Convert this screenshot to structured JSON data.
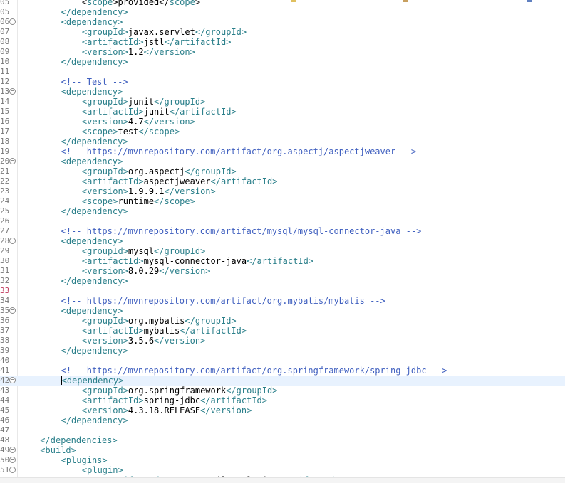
{
  "lines": [
    {
      "n": "05",
      "fold": false,
      "indent": 3,
      "parts": [
        [
          "txt",
          "<"
        ],
        [
          "tag",
          "scope"
        ],
        [
          "txt",
          ">provided</"
        ],
        [
          "tag",
          "scope"
        ],
        [
          "txt",
          ">"
        ]
      ]
    },
    {
      "n": "05",
      "fold": false,
      "indent": 2,
      "parts": [
        [
          "tag",
          "</dependency>"
        ]
      ]
    },
    {
      "n": "06",
      "fold": true,
      "indent": 2,
      "parts": [
        [
          "tag",
          "<dependency>"
        ]
      ]
    },
    {
      "n": "07",
      "fold": false,
      "indent": 3,
      "parts": [
        [
          "tag",
          "<groupId>"
        ],
        [
          "txt",
          "javax.servlet"
        ],
        [
          "tag",
          "</groupId>"
        ]
      ]
    },
    {
      "n": "08",
      "fold": false,
      "indent": 3,
      "parts": [
        [
          "tag",
          "<artifactId>"
        ],
        [
          "txt",
          "jstl"
        ],
        [
          "tag",
          "</artifactId>"
        ]
      ]
    },
    {
      "n": "09",
      "fold": false,
      "indent": 3,
      "parts": [
        [
          "tag",
          "<version>"
        ],
        [
          "txt",
          "1.2"
        ],
        [
          "tag",
          "</version>"
        ]
      ]
    },
    {
      "n": "10",
      "fold": false,
      "indent": 2,
      "parts": [
        [
          "tag",
          "</dependency>"
        ]
      ]
    },
    {
      "n": "11",
      "fold": false,
      "indent": 0,
      "parts": []
    },
    {
      "n": "12",
      "fold": false,
      "indent": 2,
      "parts": [
        [
          "cmt",
          "<!-- Test -->"
        ]
      ]
    },
    {
      "n": "13",
      "fold": true,
      "indent": 2,
      "parts": [
        [
          "tag",
          "<dependency>"
        ]
      ]
    },
    {
      "n": "14",
      "fold": false,
      "indent": 3,
      "parts": [
        [
          "tag",
          "<groupId>"
        ],
        [
          "txt",
          "junit"
        ],
        [
          "tag",
          "</groupId>"
        ]
      ]
    },
    {
      "n": "15",
      "fold": false,
      "indent": 3,
      "parts": [
        [
          "tag",
          "<artifactId>"
        ],
        [
          "txt",
          "junit"
        ],
        [
          "tag",
          "</artifactId>"
        ]
      ]
    },
    {
      "n": "16",
      "fold": false,
      "indent": 3,
      "parts": [
        [
          "tag",
          "<version>"
        ],
        [
          "txt",
          "4.7"
        ],
        [
          "tag",
          "</version>"
        ]
      ]
    },
    {
      "n": "17",
      "fold": false,
      "indent": 3,
      "parts": [
        [
          "tag",
          "<scope>"
        ],
        [
          "txt",
          "test"
        ],
        [
          "tag",
          "</scope>"
        ]
      ]
    },
    {
      "n": "18",
      "fold": false,
      "indent": 2,
      "parts": [
        [
          "tag",
          "</dependency>"
        ]
      ]
    },
    {
      "n": "19",
      "fold": false,
      "indent": 2,
      "parts": [
        [
          "cmt",
          "<!-- https://mvnrepository.com/artifact/org.aspectj/aspectjweaver -->"
        ]
      ]
    },
    {
      "n": "20",
      "fold": true,
      "indent": 2,
      "parts": [
        [
          "tag",
          "<dependency>"
        ]
      ]
    },
    {
      "n": "21",
      "fold": false,
      "indent": 3,
      "parts": [
        [
          "tag",
          "<groupId>"
        ],
        [
          "txt",
          "org.aspectj"
        ],
        [
          "tag",
          "</groupId>"
        ]
      ]
    },
    {
      "n": "22",
      "fold": false,
      "indent": 3,
      "parts": [
        [
          "tag",
          "<artifactId>"
        ],
        [
          "txt",
          "aspectjweaver"
        ],
        [
          "tag",
          "</artifactId>"
        ]
      ]
    },
    {
      "n": "23",
      "fold": false,
      "indent": 3,
      "parts": [
        [
          "tag",
          "<version>"
        ],
        [
          "txt",
          "1.9.9.1"
        ],
        [
          "tag",
          "</version>"
        ]
      ]
    },
    {
      "n": "24",
      "fold": false,
      "indent": 3,
      "parts": [
        [
          "tag",
          "<scope>"
        ],
        [
          "txt",
          "runtime"
        ],
        [
          "tag",
          "</scope>"
        ]
      ]
    },
    {
      "n": "25",
      "fold": false,
      "indent": 2,
      "parts": [
        [
          "tag",
          "</dependency>"
        ]
      ]
    },
    {
      "n": "26",
      "fold": false,
      "indent": 0,
      "parts": []
    },
    {
      "n": "27",
      "fold": false,
      "indent": 2,
      "parts": [
        [
          "cmt",
          "<!-- https://mvnrepository.com/artifact/mysql/mysql-connector-java -->"
        ]
      ]
    },
    {
      "n": "28",
      "fold": true,
      "indent": 2,
      "parts": [
        [
          "tag",
          "<dependency>"
        ]
      ]
    },
    {
      "n": "29",
      "fold": false,
      "indent": 3,
      "parts": [
        [
          "tag",
          "<groupId>"
        ],
        [
          "txt",
          "mysql"
        ],
        [
          "tag",
          "</groupId>"
        ]
      ]
    },
    {
      "n": "30",
      "fold": false,
      "indent": 3,
      "parts": [
        [
          "tag",
          "<artifactId>"
        ],
        [
          "txt",
          "mysql-connector-java"
        ],
        [
          "tag",
          "</artifactId>"
        ]
      ]
    },
    {
      "n": "31",
      "fold": false,
      "indent": 3,
      "parts": [
        [
          "tag",
          "<version>"
        ],
        [
          "txt",
          "8.0.29"
        ],
        [
          "tag",
          "</version>"
        ]
      ]
    },
    {
      "n": "32",
      "fold": false,
      "indent": 2,
      "parts": [
        [
          "tag",
          "</dependency>"
        ]
      ]
    },
    {
      "n": "33",
      "fold": false,
      "indent": 0,
      "changed": true,
      "parts": []
    },
    {
      "n": "34",
      "fold": false,
      "indent": 2,
      "parts": [
        [
          "cmt",
          "<!-- https://mvnrepository.com/artifact/org.mybatis/mybatis -->"
        ]
      ]
    },
    {
      "n": "35",
      "fold": true,
      "indent": 2,
      "parts": [
        [
          "tag",
          "<dependency>"
        ]
      ]
    },
    {
      "n": "36",
      "fold": false,
      "indent": 3,
      "parts": [
        [
          "tag",
          "<groupId>"
        ],
        [
          "txt",
          "org.mybatis"
        ],
        [
          "tag",
          "</groupId>"
        ]
      ]
    },
    {
      "n": "37",
      "fold": false,
      "indent": 3,
      "parts": [
        [
          "tag",
          "<artifactId>"
        ],
        [
          "txt",
          "mybatis"
        ],
        [
          "tag",
          "</artifactId>"
        ]
      ]
    },
    {
      "n": "38",
      "fold": false,
      "indent": 3,
      "parts": [
        [
          "tag",
          "<version>"
        ],
        [
          "txt",
          "3.5.6"
        ],
        [
          "tag",
          "</version>"
        ]
      ]
    },
    {
      "n": "39",
      "fold": false,
      "indent": 2,
      "parts": [
        [
          "tag",
          "</dependency>"
        ]
      ]
    },
    {
      "n": "40",
      "fold": false,
      "indent": 0,
      "parts": []
    },
    {
      "n": "41",
      "fold": false,
      "indent": 2,
      "parts": [
        [
          "cmt",
          "<!-- https://mvnrepository.com/artifact/org.springframework/spring-jdbc -->"
        ]
      ]
    },
    {
      "n": "42",
      "fold": true,
      "indent": 2,
      "current": true,
      "caret": true,
      "parts": [
        [
          "tag",
          "<dependency>"
        ]
      ]
    },
    {
      "n": "43",
      "fold": false,
      "indent": 3,
      "parts": [
        [
          "tag",
          "<groupId>"
        ],
        [
          "txt",
          "org.springframework"
        ],
        [
          "tag",
          "</groupId>"
        ]
      ]
    },
    {
      "n": "44",
      "fold": false,
      "indent": 3,
      "parts": [
        [
          "tag",
          "<artifactId>"
        ],
        [
          "txt",
          "spring-jdbc"
        ],
        [
          "tag",
          "</artifactId>"
        ]
      ]
    },
    {
      "n": "45",
      "fold": false,
      "indent": 3,
      "parts": [
        [
          "tag",
          "<version>"
        ],
        [
          "txt",
          "4.3.18.RELEASE"
        ],
        [
          "tag",
          "</version>"
        ]
      ]
    },
    {
      "n": "46",
      "fold": false,
      "indent": 2,
      "parts": [
        [
          "tag",
          "</dependency>"
        ]
      ]
    },
    {
      "n": "47",
      "fold": false,
      "indent": 0,
      "parts": []
    },
    {
      "n": "48",
      "fold": false,
      "indent": 1,
      "parts": [
        [
          "tag",
          "</dependencies>"
        ]
      ]
    },
    {
      "n": "49",
      "fold": true,
      "indent": 1,
      "parts": [
        [
          "tag",
          "<build>"
        ]
      ]
    },
    {
      "n": "50",
      "fold": true,
      "indent": 2,
      "parts": [
        [
          "tag",
          "<plugins>"
        ]
      ]
    },
    {
      "n": "51",
      "fold": true,
      "indent": 3,
      "parts": [
        [
          "tag",
          "<plugin>"
        ]
      ]
    },
    {
      "n": "52",
      "fold": false,
      "indent": 4,
      "parts": [
        [
          "tag",
          "<artifactId>"
        ],
        [
          "txt",
          "maven-compiler-plugin"
        ],
        [
          "tag",
          "</artifactId>"
        ]
      ]
    }
  ],
  "colors": {
    "tag": "#2a7f8a",
    "text": "#000000",
    "comment": "#3f5fbf",
    "current_line": "#e8f2fe"
  }
}
